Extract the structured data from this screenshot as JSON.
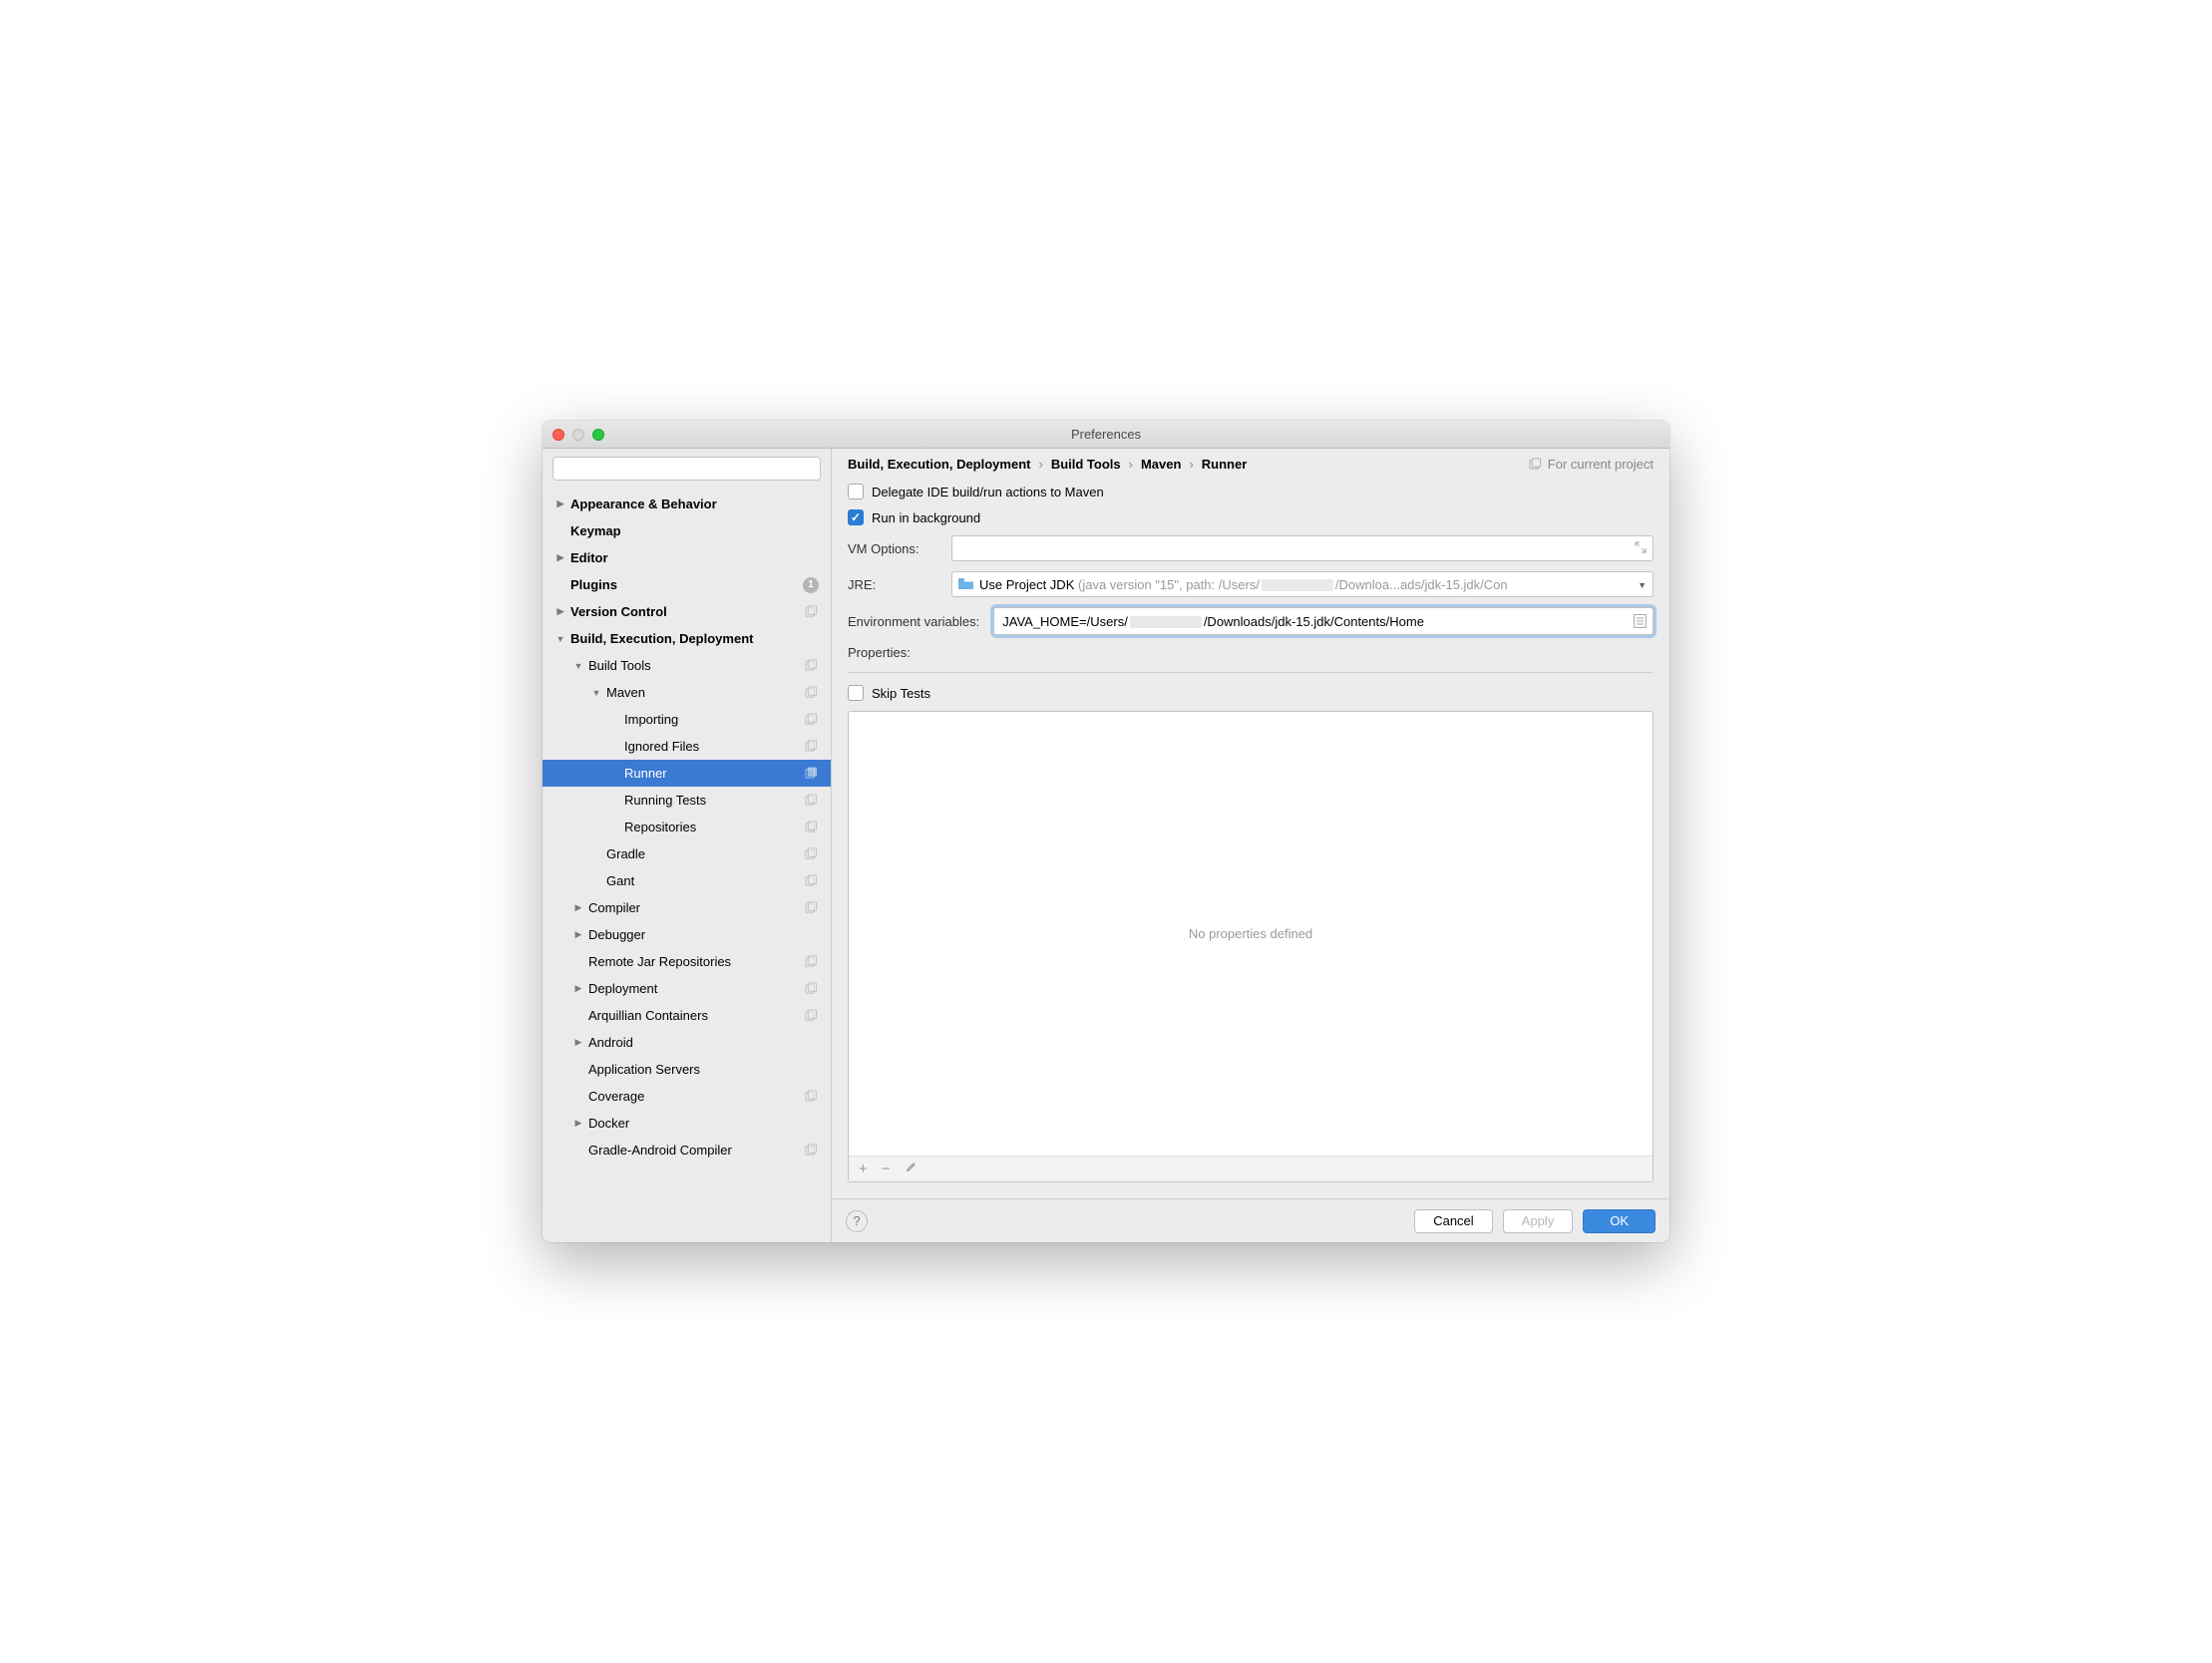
{
  "window_title": "Preferences",
  "search_placeholder": "",
  "breadcrumb": [
    "Build, Execution, Deployment",
    "Build Tools",
    "Maven",
    "Runner"
  ],
  "project_scope_label": "For current project",
  "checkboxes": {
    "delegate": {
      "label": "Delegate IDE build/run actions to Maven",
      "checked": false
    },
    "background": {
      "label": "Run in background",
      "checked": true
    },
    "skip_tests": {
      "label": "Skip Tests",
      "checked": false
    }
  },
  "labels": {
    "vm_options": "VM Options:",
    "jre": "JRE:",
    "env_vars": "Environment variables:",
    "properties": "Properties:"
  },
  "vm_options_value": "",
  "jre": {
    "main": "Use Project JDK",
    "detail_prefix": "(java version \"15\", path: /Users/",
    "detail_suffix": "/Downloa...ads/jdk-15.jdk/Con"
  },
  "env_value_prefix": "JAVA_HOME=/Users/",
  "env_value_suffix": "/Downloads/jdk-15.jdk/Contents/Home",
  "properties_empty": "No properties defined",
  "buttons": {
    "cancel": "Cancel",
    "apply": "Apply",
    "ok": "OK"
  },
  "plugins_count": "1",
  "tree": [
    {
      "label": "Appearance & Behavior",
      "depth": 0,
      "bold": true,
      "arrow": "right",
      "stack": false
    },
    {
      "label": "Keymap",
      "depth": 0,
      "bold": true,
      "arrow": "",
      "stack": false
    },
    {
      "label": "Editor",
      "depth": 0,
      "bold": true,
      "arrow": "right",
      "stack": false
    },
    {
      "label": "Plugins",
      "depth": 0,
      "bold": true,
      "arrow": "",
      "stack": false,
      "count": true
    },
    {
      "label": "Version Control",
      "depth": 0,
      "bold": true,
      "arrow": "right",
      "stack": true
    },
    {
      "label": "Build, Execution, Deployment",
      "depth": 0,
      "bold": true,
      "arrow": "down",
      "stack": false
    },
    {
      "label": "Build Tools",
      "depth": 1,
      "bold": false,
      "arrow": "down",
      "stack": true
    },
    {
      "label": "Maven",
      "depth": 2,
      "bold": false,
      "arrow": "down",
      "stack": true
    },
    {
      "label": "Importing",
      "depth": 3,
      "bold": false,
      "arrow": "",
      "stack": true
    },
    {
      "label": "Ignored Files",
      "depth": 3,
      "bold": false,
      "arrow": "",
      "stack": true
    },
    {
      "label": "Runner",
      "depth": 3,
      "bold": false,
      "arrow": "",
      "stack": true,
      "selected": true
    },
    {
      "label": "Running Tests",
      "depth": 3,
      "bold": false,
      "arrow": "",
      "stack": true
    },
    {
      "label": "Repositories",
      "depth": 3,
      "bold": false,
      "arrow": "",
      "stack": true
    },
    {
      "label": "Gradle",
      "depth": 2,
      "bold": false,
      "arrow": "",
      "stack": true
    },
    {
      "label": "Gant",
      "depth": 2,
      "bold": false,
      "arrow": "",
      "stack": true
    },
    {
      "label": "Compiler",
      "depth": 1,
      "bold": false,
      "arrow": "right",
      "stack": true
    },
    {
      "label": "Debugger",
      "depth": 1,
      "bold": false,
      "arrow": "right",
      "stack": false
    },
    {
      "label": "Remote Jar Repositories",
      "depth": 1,
      "bold": false,
      "arrow": "",
      "stack": true
    },
    {
      "label": "Deployment",
      "depth": 1,
      "bold": false,
      "arrow": "right",
      "stack": true
    },
    {
      "label": "Arquillian Containers",
      "depth": 1,
      "bold": false,
      "arrow": "",
      "stack": true
    },
    {
      "label": "Android",
      "depth": 1,
      "bold": false,
      "arrow": "right",
      "stack": false
    },
    {
      "label": "Application Servers",
      "depth": 1,
      "bold": false,
      "arrow": "",
      "stack": false
    },
    {
      "label": "Coverage",
      "depth": 1,
      "bold": false,
      "arrow": "",
      "stack": true
    },
    {
      "label": "Docker",
      "depth": 1,
      "bold": false,
      "arrow": "right",
      "stack": false
    },
    {
      "label": "Gradle-Android Compiler",
      "depth": 1,
      "bold": false,
      "arrow": "",
      "stack": true
    }
  ]
}
